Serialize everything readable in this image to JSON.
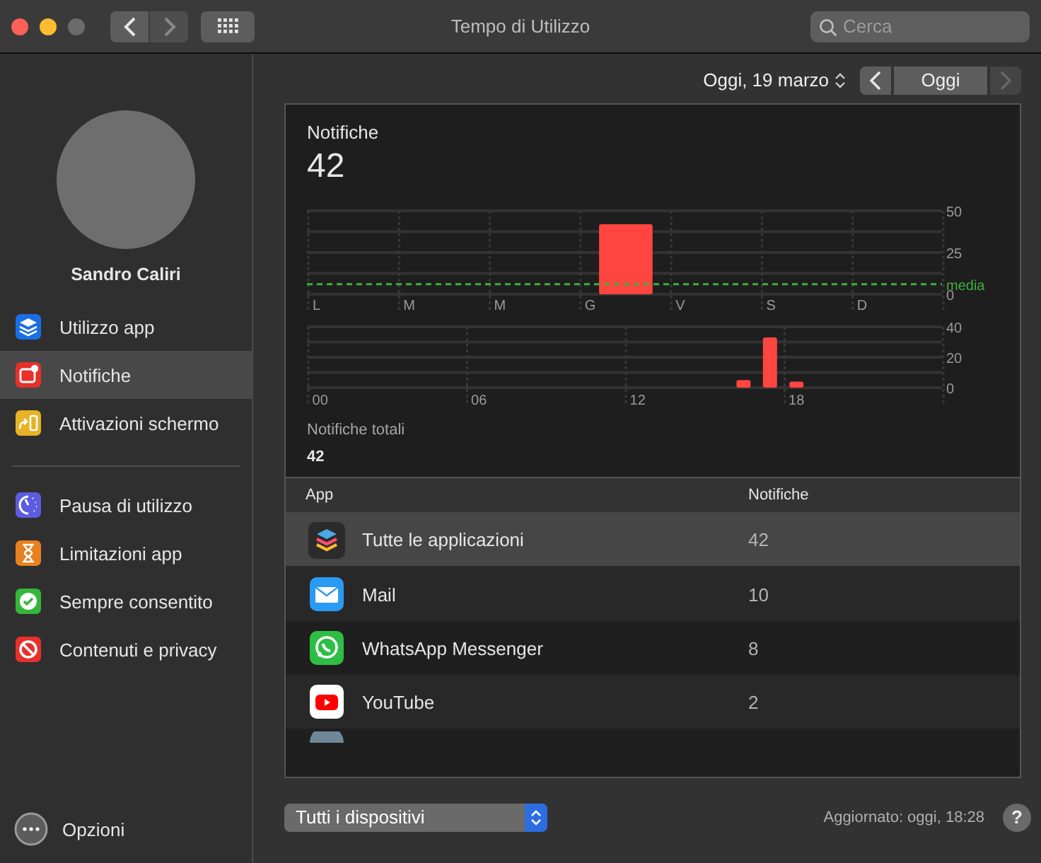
{
  "window": {
    "title": "Tempo di Utilizzo",
    "search_placeholder": "Cerca"
  },
  "sidebar": {
    "user": "Sandro Caliri",
    "groups": [
      {
        "items": [
          {
            "label": "Utilizzo app",
            "selected": false
          },
          {
            "label": "Notifiche",
            "selected": true
          },
          {
            "label": "Attivazioni schermo",
            "selected": false
          }
        ]
      },
      {
        "items": [
          {
            "label": "Pausa di utilizzo",
            "selected": false
          },
          {
            "label": "Limitazioni app",
            "selected": false
          },
          {
            "label": "Sempre consentito",
            "selected": false
          },
          {
            "label": "Contenuti e privacy",
            "selected": false
          }
        ]
      }
    ],
    "options": "Opzioni"
  },
  "date_bar": {
    "date": "Oggi, 19 marzo",
    "today": "Oggi",
    "next_disabled": true
  },
  "summary": {
    "title": "Notifiche",
    "value": "42",
    "total_label": "Notifiche totali",
    "total_value": "42"
  },
  "weekly_chart": {
    "chart_data": {
      "type": "bar",
      "categories": [
        "L",
        "M",
        "M",
        "G",
        "V",
        "S",
        "D"
      ],
      "series": [
        {
          "color": "#ff4540",
          "values": [
            0,
            0,
            0,
            42,
            0,
            0,
            0
          ]
        }
      ],
      "ylim": [
        0,
        50
      ],
      "yticks": [
        0,
        25,
        50
      ],
      "ref_lines": [
        {
          "axis": "y",
          "value": 6,
          "label": "media",
          "color": "#3fae3f"
        }
      ]
    }
  },
  "hourly_chart": {
    "chart_data": {
      "type": "bar",
      "x": [
        16,
        17,
        18
      ],
      "series": [
        {
          "color": "#ff4540",
          "values": [
            5,
            33,
            4
          ]
        }
      ],
      "xlim": [
        -0.5,
        23.5
      ],
      "ylim": [
        0,
        40
      ],
      "yticks": [
        0,
        20,
        40
      ],
      "xticks": [
        {
          "value": 0,
          "label": "00"
        },
        {
          "value": 6,
          "label": "06"
        },
        {
          "value": 12,
          "label": "12"
        },
        {
          "value": 18,
          "label": "18"
        }
      ]
    }
  },
  "table": {
    "columns": [
      "App",
      "Notifiche"
    ],
    "rows": [
      {
        "app": "Tutte le applicazioni",
        "count": "42",
        "selected": true
      },
      {
        "app": "Mail",
        "count": "10",
        "selected": false
      },
      {
        "app": "WhatsApp Messenger",
        "count": "8",
        "selected": false
      },
      {
        "app": "YouTube",
        "count": "2",
        "selected": false
      }
    ]
  },
  "footer": {
    "device": "Tutti i dispositivi",
    "updated": "Aggiornato: oggi, 18:28",
    "help": "?"
  }
}
